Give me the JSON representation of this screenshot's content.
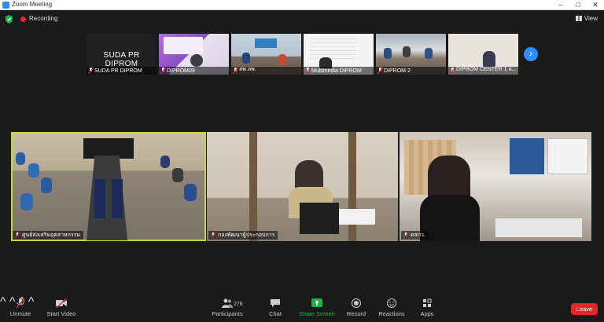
{
  "window": {
    "title": "Zoom Meeting",
    "minimize": "–",
    "maximize": "▢",
    "close": "✕"
  },
  "topbar": {
    "recording_label": "Recording",
    "view_label": "View"
  },
  "colors": {
    "accent": "#2d8cff",
    "recording": "#e02828",
    "share": "#22b04a",
    "active_speaker": "#c9d440",
    "leave": "#e02828"
  },
  "thumbnails": [
    {
      "name": "SUDA PR DIPROM",
      "big_name": "SUDA PR DIPROM",
      "muted": true
    },
    {
      "name": "DIPROM09",
      "muted": true
    },
    {
      "name": "สพ.ลพ.",
      "muted": true
    },
    {
      "name": "Multimedia DIPROM",
      "muted": true
    },
    {
      "name": "DIPROM 2",
      "muted": true
    },
    {
      "name": "DIPROM CENTER 1 ล...",
      "muted": true
    }
  ],
  "next_page_icon": "chevron-right-icon",
  "tiles": [
    {
      "name": "ศูนย์ส่งเสริมอุตสาหกรรม",
      "active": true
    },
    {
      "name": "กองพัฒนาผู้ประกอบการ",
      "active": false
    },
    {
      "name": "ดสกว.",
      "active": false
    }
  ],
  "toolbar": {
    "unmute": "Unmute",
    "start_video": "Start Video",
    "participants": "Participants",
    "participants_count": "276",
    "chat": "Chat",
    "share_screen": "Share Screen",
    "record": "Record",
    "reactions": "Reactions",
    "apps": "Apps",
    "leave": "Leave"
  }
}
